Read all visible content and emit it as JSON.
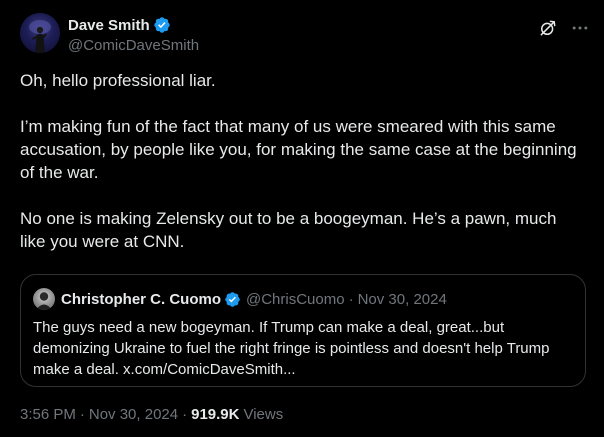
{
  "author": {
    "display_name": "Dave Smith",
    "handle": "@ComicDaveSmith",
    "verified": true
  },
  "icons": {
    "avatar": "profile-photo",
    "verified": "verified-badge-icon",
    "grok": "grok-icon",
    "more": "more-options-icon"
  },
  "tweet": {
    "paragraphs": [
      "Oh, hello professional liar.",
      "I’m making fun of the fact that many of us were smeared with this same accusation, by people like you, for making the same case at the beginning of the war.",
      "No one is making Zelensky out to be a boogeyman. He’s a pawn, much like you were at CNN."
    ]
  },
  "quote": {
    "display_name": "Christopher C. Cuomo",
    "handle": "@ChrisCuomo",
    "separator": "·",
    "date": "Nov 30, 2024",
    "verified": true,
    "text": "The guys need a new bogeyman. If Trump can make a deal, great...but demonizing Ukraine to fuel the right fringe is pointless and doesn't help Trump make a deal. x.com/ComicDaveSmith..."
  },
  "meta": {
    "time": "3:56 PM",
    "separator": "·",
    "date": "Nov 30, 2024",
    "views_count": "919.9K",
    "views_label": "Views"
  },
  "colors": {
    "background": "#000000",
    "text": "#e7e9ea",
    "muted": "#71767b",
    "border": "#2f3336",
    "verified": "#1d9bf0"
  }
}
